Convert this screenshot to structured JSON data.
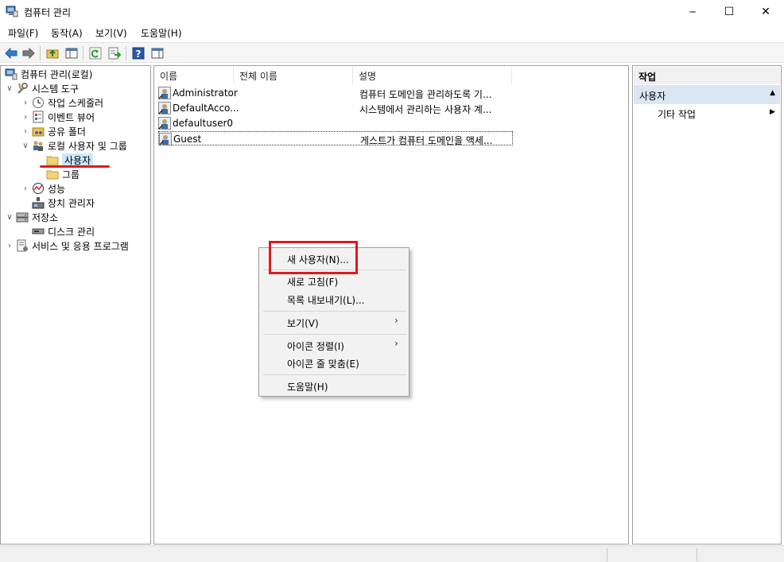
{
  "window": {
    "title": "컴퓨터 관리",
    "min_glyph": "─",
    "max_glyph": "☐",
    "close_glyph": "✕"
  },
  "menubar": {
    "items": [
      "파일(F)",
      "동작(A)",
      "보기(V)",
      "도움말(H)"
    ]
  },
  "tree": {
    "items": [
      {
        "label": "컴퓨터 관리(로컬)",
        "icon": "computer-management-icon"
      },
      {
        "label": "시스템 도구",
        "icon": "tools-icon"
      },
      {
        "label": "작업 스케줄러",
        "icon": "clock-icon"
      },
      {
        "label": "이벤트 뷰어",
        "icon": "event-viewer-icon"
      },
      {
        "label": "공유 폴더",
        "icon": "shared-folder-icon"
      },
      {
        "label": "로컬 사용자 및 그룹",
        "icon": "users-groups-icon"
      },
      {
        "label": "사용자",
        "icon": "folder-icon"
      },
      {
        "label": "그룹",
        "icon": "folder-icon"
      },
      {
        "label": "성능",
        "icon": "performance-icon"
      },
      {
        "label": "장치 관리자",
        "icon": "device-manager-icon"
      },
      {
        "label": "저장소",
        "icon": "storage-icon"
      },
      {
        "label": "디스크 관리",
        "icon": "disk-icon"
      },
      {
        "label": "서비스 및 응용 프로그램",
        "icon": "services-icon"
      }
    ]
  },
  "list": {
    "columns": [
      "이름",
      "전체 이름",
      "설명"
    ],
    "rows": [
      {
        "name": "Administrator",
        "full_name": "",
        "description": "컴퓨터 도메인을 관리하도록 기..."
      },
      {
        "name": "DefaultAcco...",
        "full_name": "",
        "description": "시스템에서 관리하는 사용자 계..."
      },
      {
        "name": "defaultuser0",
        "full_name": "",
        "description": ""
      },
      {
        "name": "Guest",
        "full_name": "",
        "description": "게스트가 컴퓨터 도메인을 액세..."
      }
    ]
  },
  "context_menu": {
    "items": [
      "새 사용자(N)...",
      "새로 고침(F)",
      "목록 내보내기(L)...",
      "보기(V)",
      "아이콘 정렬(I)",
      "아이콘 줄 맞춤(E)",
      "도움말(H)"
    ],
    "submenu_glyph": "›"
  },
  "actions": {
    "header": "작업",
    "section": "사용자",
    "section_glyph": "▲",
    "item": "기타 작업",
    "item_glyph": "▶"
  },
  "colors": {
    "annotation_red": "#e0191e",
    "selection_blue": "#cce8ff",
    "actions_section": "#dbe6f3"
  }
}
